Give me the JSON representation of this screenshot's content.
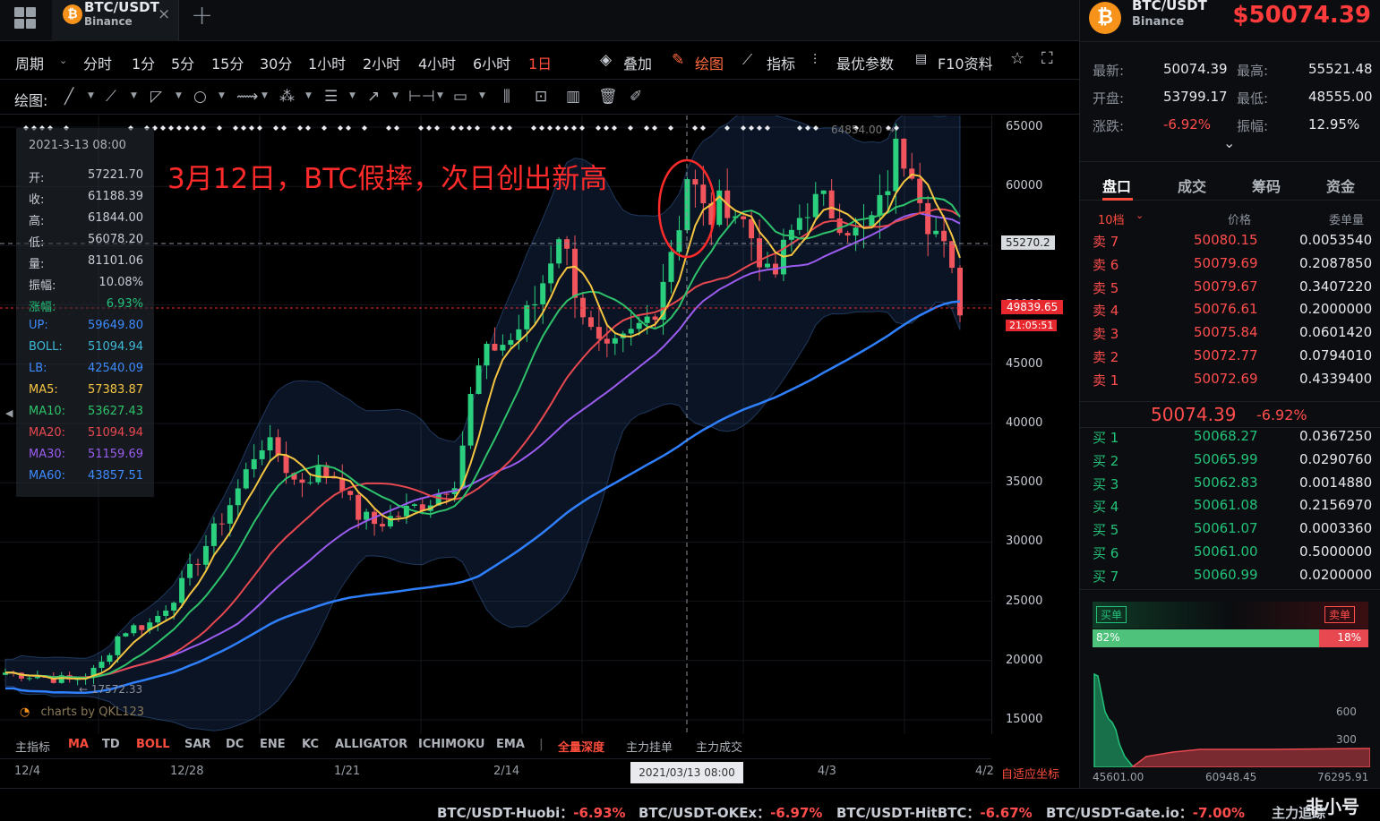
{
  "tab": {
    "title": "BTC/USDT",
    "exchange": "Binance"
  },
  "periods": [
    "周期",
    "分时",
    "1分",
    "5分",
    "15分",
    "30分",
    "1小时",
    "2小时",
    "4小时",
    "6小时",
    "1日"
  ],
  "active_period": "1日",
  "right_tools": {
    "overlay": "叠加",
    "draw": "绘图",
    "indicators": "指标",
    "best_params": "最优参数",
    "f10": "F10资料"
  },
  "drawbar_label": "绘图:",
  "annotation": "3月12日，BTC假摔，次日创出新高",
  "watermark": "charts by QKL123",
  "info": {
    "date": "2021-3-13 08:00",
    "rows": [
      {
        "k": "开:",
        "v": "57221.70",
        "c": "#c8ccd4"
      },
      {
        "k": "收:",
        "v": "61188.39",
        "c": "#c8ccd4"
      },
      {
        "k": "高:",
        "v": "61844.00",
        "c": "#c8ccd4"
      },
      {
        "k": "低:",
        "v": "56078.20",
        "c": "#c8ccd4"
      },
      {
        "k": "量:",
        "v": "81101.06",
        "c": "#c8ccd4"
      },
      {
        "k": "振幅:",
        "v": "10.08%",
        "c": "#c8ccd4"
      },
      {
        "k": "涨幅:",
        "v": "6.93%",
        "c": "#23c27a"
      },
      {
        "k": "UP:",
        "v": "59649.80",
        "c": "#3d8bfd"
      },
      {
        "k": "BOLL:",
        "v": "51094.94",
        "c": "#3fb8d8"
      },
      {
        "k": "LB:",
        "v": "42540.09",
        "c": "#3d8bfd"
      },
      {
        "k": "MA5:",
        "v": "57383.87",
        "c": "#f5c542"
      },
      {
        "k": "MA10:",
        "v": "53627.43",
        "c": "#2ec36b"
      },
      {
        "k": "MA20:",
        "v": "51094.94",
        "c": "#e8484f"
      },
      {
        "k": "MA30:",
        "v": "51159.69",
        "c": "#9b5cf0"
      },
      {
        "k": "MA60:",
        "v": "43857.51",
        "c": "#3d8bfd"
      }
    ]
  },
  "price_axis": [
    "65000",
    "60000",
    "55000",
    "50000",
    "45000",
    "40000",
    "35000",
    "30000",
    "25000",
    "20000",
    "15000"
  ],
  "crosshair_price": "55270.2",
  "current_price_tag": "49839.65",
  "countdown": "21:05:51",
  "peak_label": "64854.00",
  "low_label": "17572.33",
  "bottom_indicators": [
    "主指标",
    "MA",
    "TD",
    "BOLL",
    "SAR",
    "DC",
    "ENE",
    "KC",
    "ALLIGATOR",
    "ICHIMOKU",
    "EMA",
    "全量深度",
    "主力挂单",
    "主力成交"
  ],
  "date_axis": [
    "12/4",
    "12/28",
    "1/21",
    "2/14",
    "4/3",
    "4/2"
  ],
  "crosshair_date": "2021/03/13 08:00",
  "auto_scale": "自适应坐标",
  "panel": {
    "symbol": "BTC/USDT",
    "exchange": "Binance",
    "price": "$50074.39",
    "stats": [
      {
        "k": "最新:",
        "v": "50074.39",
        "c": "#e8eaed"
      },
      {
        "k": "最高:",
        "v": "55521.48",
        "c": "#e8eaed"
      },
      {
        "k": "开盘:",
        "v": "53799.17",
        "c": "#e8eaed"
      },
      {
        "k": "最低:",
        "v": "48555.00",
        "c": "#e8eaed"
      },
      {
        "k": "涨跌:",
        "v": "-6.92%",
        "c": "#ff4d4d"
      },
      {
        "k": "振幅:",
        "v": "12.95%",
        "c": "#e8eaed"
      }
    ],
    "tabs": [
      "盘口",
      "成交",
      "筹码",
      "资金"
    ],
    "depth_select": "10档",
    "col_price": "价格",
    "col_qty": "委单量",
    "asks": [
      {
        "s": "卖 7",
        "p": "50080.15",
        "q": "0.0053540"
      },
      {
        "s": "卖 6",
        "p": "50079.69",
        "q": "0.2087850"
      },
      {
        "s": "卖 5",
        "p": "50079.67",
        "q": "0.3407220"
      },
      {
        "s": "卖 4",
        "p": "50076.61",
        "q": "0.2000000"
      },
      {
        "s": "卖 3",
        "p": "50075.84",
        "q": "0.0601420"
      },
      {
        "s": "卖 2",
        "p": "50072.77",
        "q": "0.0794010"
      },
      {
        "s": "卖 1",
        "p": "50072.69",
        "q": "0.4339400"
      }
    ],
    "mid_price": "50074.39",
    "mid_change": "-6.92%",
    "bids": [
      {
        "s": "买 1",
        "p": "50068.27",
        "q": "0.0367250"
      },
      {
        "s": "买 2",
        "p": "50065.99",
        "q": "0.0290760"
      },
      {
        "s": "买 3",
        "p": "50062.83",
        "q": "0.0014880"
      },
      {
        "s": "买 4",
        "p": "50061.08",
        "q": "0.2156970"
      },
      {
        "s": "买 5",
        "p": "50061.07",
        "q": "0.0003360"
      },
      {
        "s": "买 6",
        "p": "50061.00",
        "q": "0.5000000"
      },
      {
        "s": "买 7",
        "p": "50060.99",
        "q": "0.0200000"
      }
    ],
    "buy_label": "买单",
    "sell_label": "卖单",
    "buy_pct": "82%",
    "sell_pct": "18%",
    "buy_ratio": 0.82,
    "depth_y": [
      "600",
      "300"
    ],
    "depth_x": [
      "45601.00",
      "60948.45",
      "76295.91"
    ]
  },
  "tickers": [
    {
      "name": "BTC/USDT-Huobi：",
      "chg": "-6.93%"
    },
    {
      "name": "BTC/USDT-OKEx：",
      "chg": "-6.97%"
    },
    {
      "name": "BTC/USDT-HitBTC：",
      "chg": "-6.67%"
    },
    {
      "name": "BTC/USDT-Gate.io：",
      "chg": "-7.00%"
    }
  ],
  "footer_right": "主力追踪",
  "brand": "非小号"
}
